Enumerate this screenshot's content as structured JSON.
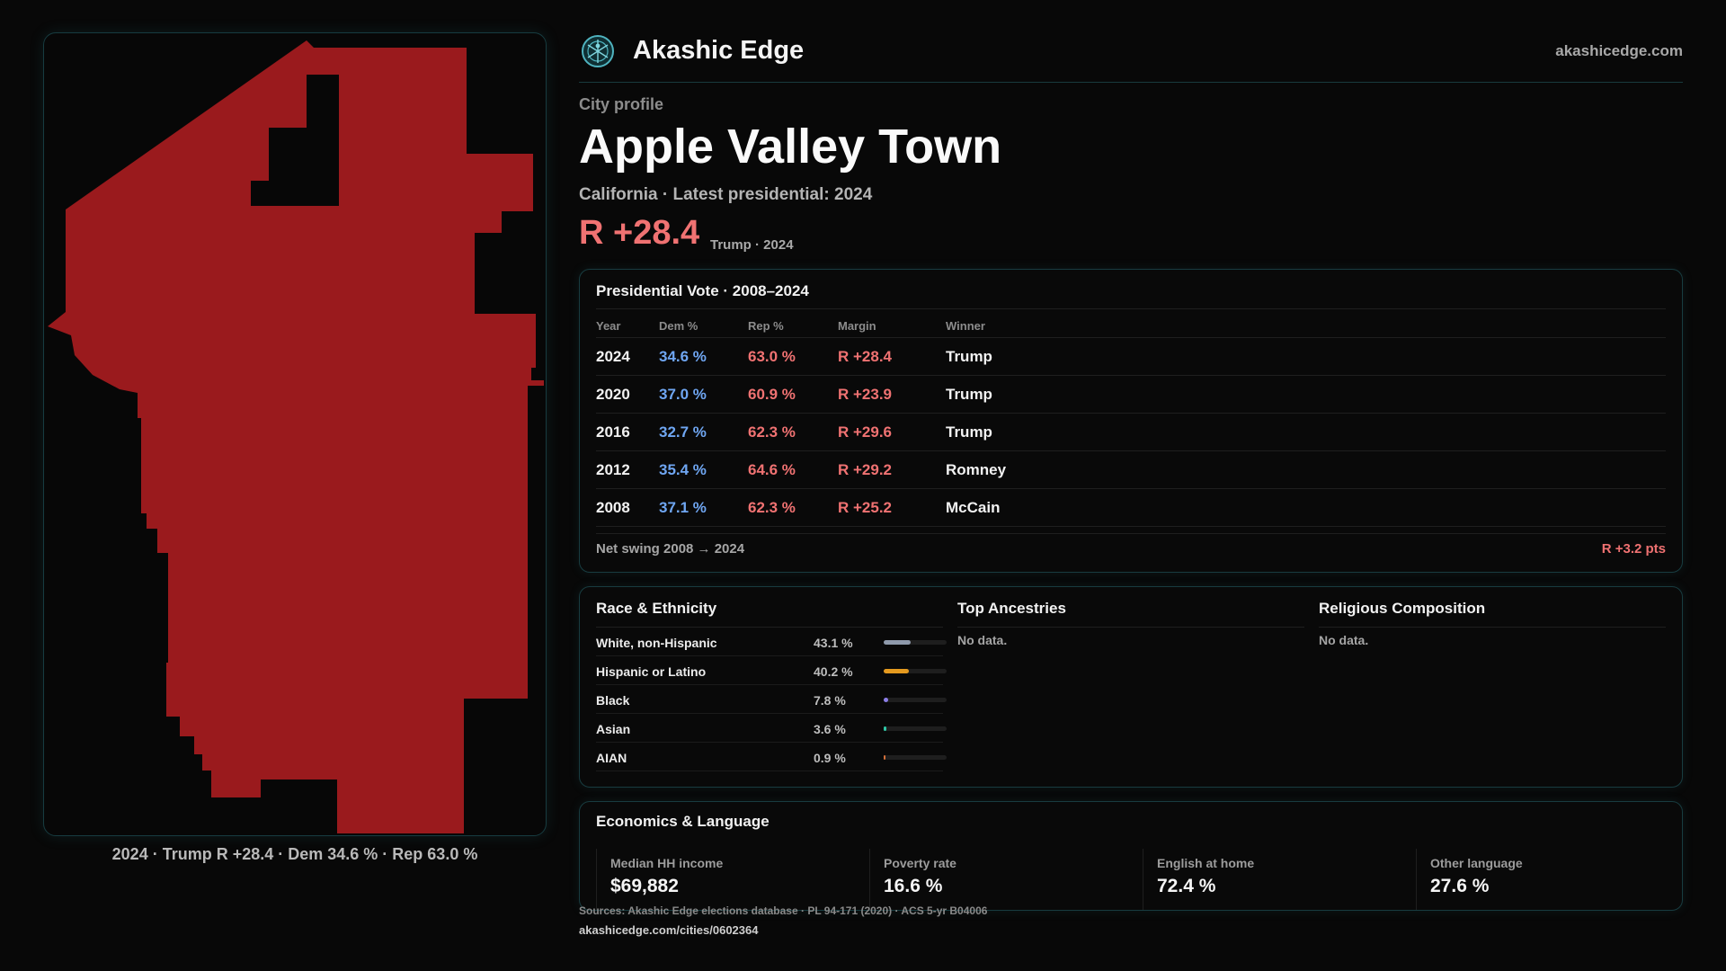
{
  "header": {
    "brand": "Akashic Edge",
    "domain": "akashicedge.com",
    "logo_icon": "akashic-edge-logo-icon"
  },
  "profile": {
    "eyebrow": "City profile",
    "title": "Apple Valley Town",
    "subtitle": "California · Latest presidential: 2024",
    "margin": "R +28.4",
    "margin_note": "Trump · 2024"
  },
  "map": {
    "caption": "2024 · Trump R +28.4 · Dem 34.6 % · Rep 63.0 %",
    "fill_color": "#9a1a1d",
    "party": "Republican"
  },
  "vote": {
    "title": "Presidential Vote · 2008–2024",
    "columns": [
      "Year",
      "Dem %",
      "Rep %",
      "Margin",
      "Winner"
    ],
    "rows": [
      {
        "year": "2024",
        "dem": "34.6 %",
        "rep": "63.0 %",
        "margin": "R +28.4",
        "winner": "Trump"
      },
      {
        "year": "2020",
        "dem": "37.0 %",
        "rep": "60.9 %",
        "margin": "R +23.9",
        "winner": "Trump"
      },
      {
        "year": "2016",
        "dem": "32.7 %",
        "rep": "62.3 %",
        "margin": "R +29.6",
        "winner": "Trump"
      },
      {
        "year": "2012",
        "dem": "35.4 %",
        "rep": "64.6 %",
        "margin": "R +29.2",
        "winner": "Romney"
      },
      {
        "year": "2008",
        "dem": "37.1 %",
        "rep": "62.3 %",
        "margin": "R +25.2",
        "winner": "McCain"
      }
    ],
    "swing_label": "Net swing 2008 → 2024",
    "swing_value": "R +3.2 pts",
    "colors": {
      "dem": "#6fa6f2",
      "rep": "#f07272"
    }
  },
  "race": {
    "title": "Race & Ethnicity",
    "rows": [
      {
        "name": "White, non-Hispanic",
        "pct": "43.1 %",
        "value": 43.1,
        "color": "#8f9aac"
      },
      {
        "name": "Hispanic or Latino",
        "pct": "40.2 %",
        "value": 40.2,
        "color": "#e59a1f"
      },
      {
        "name": "Black",
        "pct": "7.8 %",
        "value": 7.8,
        "color": "#8c7ee8"
      },
      {
        "name": "Asian",
        "pct": "3.6 %",
        "value": 3.6,
        "color": "#2fc7a6"
      },
      {
        "name": "AIAN",
        "pct": "0.9 %",
        "value": 0.9,
        "color": "#d4703a"
      }
    ]
  },
  "ancestries": {
    "title": "Top Ancestries",
    "empty": "No data."
  },
  "religion": {
    "title": "Religious Composition",
    "empty": "No data."
  },
  "economics": {
    "title": "Economics & Language",
    "items": [
      {
        "label": "Median HH income",
        "value": "$69,882"
      },
      {
        "label": "Poverty rate",
        "value": "16.6 %"
      },
      {
        "label": "English at home",
        "value": "72.4 %"
      },
      {
        "label": "Other language",
        "value": "27.6 %"
      }
    ]
  },
  "footer": {
    "sources": "Sources: Akashic Edge elections database · PL 94-171 (2020) · ACS 5-yr B04006",
    "url": "akashicedge.com/cities/0602364"
  }
}
